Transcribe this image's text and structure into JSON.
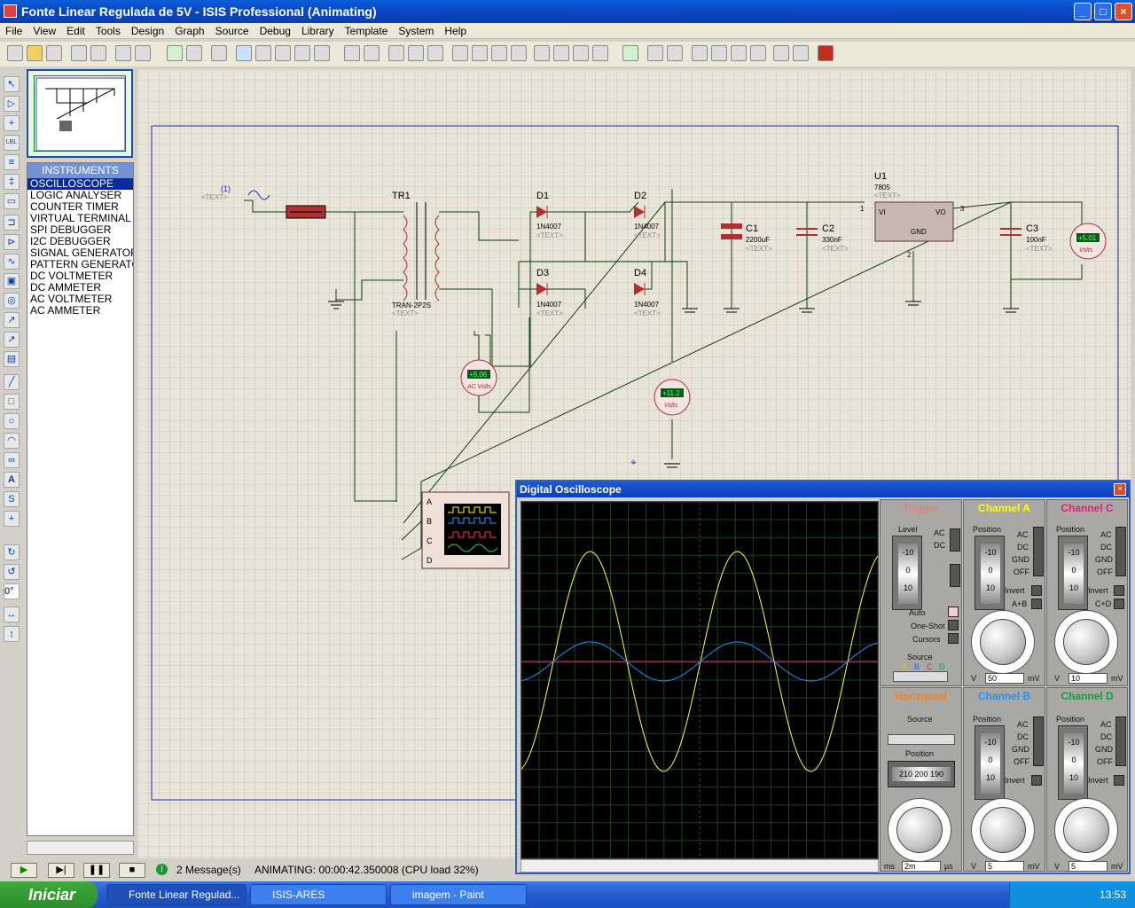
{
  "window": {
    "title": "Fonte Linear Regulada de 5V - ISIS Professional (Animating)",
    "min": "_",
    "max": "□",
    "close": "×"
  },
  "menu": [
    "File",
    "View",
    "Edit",
    "Tools",
    "Design",
    "Graph",
    "Source",
    "Debug",
    "Library",
    "Template",
    "System",
    "Help"
  ],
  "instruments": {
    "header": "INSTRUMENTS",
    "items": [
      "OSCILLOSCOPE",
      "LOGIC ANALYSER",
      "COUNTER TIMER",
      "VIRTUAL TERMINAL",
      "SPI DEBUGGER",
      "I2C DEBUGGER",
      "SIGNAL GENERATOR",
      "PATTERN GENERATOR",
      "DC VOLTMETER",
      "DC AMMETER",
      "AC VOLTMETER",
      "AC AMMETER"
    ],
    "selected": "OSCILLOSCOPE"
  },
  "left_tools": {
    "angle": "0°"
  },
  "schematic": {
    "text_tag": "<TEXT>",
    "source_label": "(1)",
    "transformer": {
      "ref": "TR1",
      "part": "TRAN-2P2S"
    },
    "diodes": [
      {
        "ref": "D1",
        "part": "1N4007"
      },
      {
        "ref": "D2",
        "part": "1N4007"
      },
      {
        "ref": "D3",
        "part": "1N4007"
      },
      {
        "ref": "D4",
        "part": "1N4007"
      }
    ],
    "caps": [
      {
        "ref": "C1",
        "value": "2200uF"
      },
      {
        "ref": "C2",
        "value": "330nF"
      },
      {
        "ref": "C3",
        "value": "100nF"
      }
    ],
    "regulator": {
      "ref": "U1",
      "part": "7805",
      "vi": "VI",
      "vo": "VO",
      "gnd": "GND",
      "pin1": "1",
      "pin2": "2",
      "pin3": "3"
    },
    "meters": [
      {
        "reading": "+9.06",
        "unit": "AC Volts"
      },
      {
        "reading": "+11.2",
        "unit": "Volts"
      },
      {
        "reading": "+5.01",
        "unit": "Volts"
      }
    ],
    "scope_pins": [
      "A",
      "B",
      "C",
      "D"
    ]
  },
  "oscilloscope": {
    "title": "Digital Oscilloscope",
    "close": "×",
    "trigger": {
      "title": "Trigger",
      "level": "Level",
      "ac": "AC",
      "dc": "DC",
      "auto": "Auto",
      "oneshot": "One-Shot",
      "cursors": "Cursors",
      "source": "Source",
      "src_letters": [
        "A",
        "B",
        "C",
        "D"
      ]
    },
    "channels": [
      {
        "title": "Channel A",
        "color": "#ffff00",
        "position": "Position",
        "ac": "AC",
        "dc": "DC",
        "gnd": "GND",
        "off": "OFF",
        "invert": "Invert",
        "extra": "A+B",
        "value": "50",
        "unit_v": "V",
        "unit_mv": "mV"
      },
      {
        "title": "Channel C",
        "color": "#e0207a",
        "position": "Position",
        "ac": "AC",
        "dc": "DC",
        "gnd": "GND",
        "off": "OFF",
        "invert": "Invert",
        "extra": "C+D",
        "value": "10",
        "unit_v": "V",
        "unit_mv": "mV"
      },
      {
        "title": "Channel B",
        "color": "#2090ff",
        "position": "Position",
        "ac": "AC",
        "dc": "DC",
        "gnd": "GND",
        "off": "OFF",
        "invert": "Invert",
        "extra": "",
        "value": "5",
        "unit_v": "V",
        "unit_mv": "mV"
      },
      {
        "title": "Channel D",
        "color": "#10a040",
        "position": "Position",
        "ac": "AC",
        "dc": "DC",
        "gnd": "GND",
        "off": "OFF",
        "invert": "Invert",
        "extra": "",
        "value": "5",
        "unit_v": "V",
        "unit_mv": "mV"
      }
    ],
    "drum_values": [
      "-10",
      "0",
      "10"
    ],
    "horizontal": {
      "title": "Horizontal",
      "source": "Source",
      "position": "Position",
      "readout": "210 200 190",
      "value": "2m",
      "unit_ms": "ms",
      "unit_us": "µs"
    }
  },
  "status": {
    "messages": "2 Message(s)",
    "animating": "ANIMATING: 00:00:42.350008 (CPU load 32%)"
  },
  "taskbar": {
    "start": "Iniciar",
    "tasks": [
      "Fonte Linear Regulad...",
      "ISIS-ARES",
      "imagem - Paint"
    ],
    "clock": "13:53"
  }
}
